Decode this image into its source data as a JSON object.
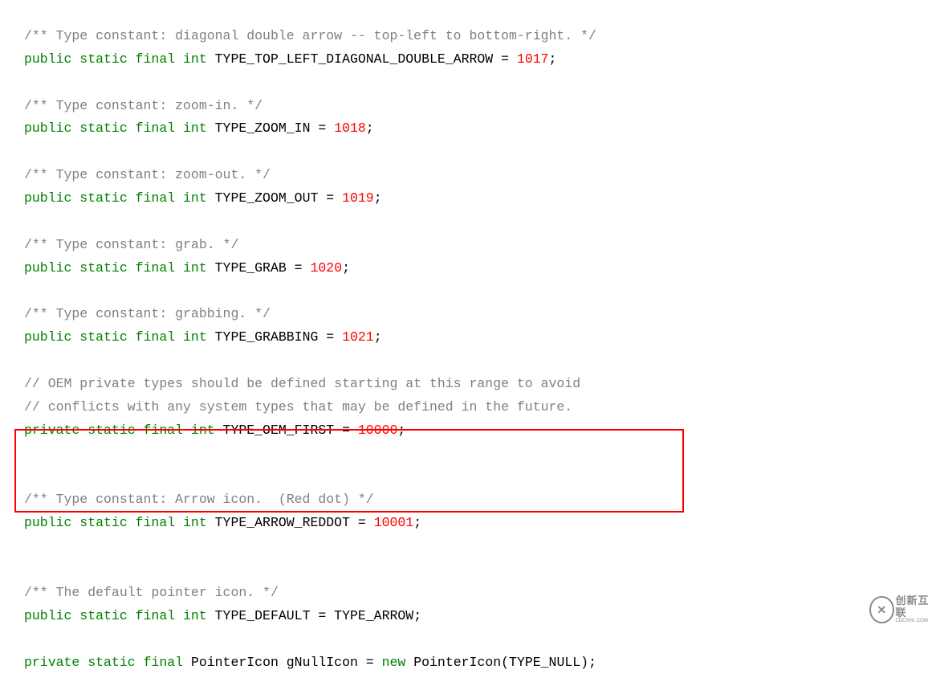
{
  "lines": {
    "c1": "/** Type constant: diagonal double arrow -- top-left to bottom-right. */",
    "l1_kw": "public static final int",
    "l1_id": " TYPE_TOP_LEFT_DIAGONAL_DOUBLE_ARROW = ",
    "l1_num": "1017",
    "semi": ";",
    "c2": "/** Type constant: zoom-in. */",
    "l2_kw": "public static final int",
    "l2_id": " TYPE_ZOOM_IN = ",
    "l2_num": "1018",
    "c3": "/** Type constant: zoom-out. */",
    "l3_kw": "public static final int",
    "l3_id": " TYPE_ZOOM_OUT = ",
    "l3_num": "1019",
    "c4": "/** Type constant: grab. */",
    "l4_kw": "public static final int",
    "l4_id": " TYPE_GRAB = ",
    "l4_num": "1020",
    "c5": "/** Type constant: grabbing. */",
    "l5_kw": "public static final int",
    "l5_id": " TYPE_GRABBING = ",
    "l5_num": "1021",
    "c6a": "// OEM private types should be defined starting at this range to avoid",
    "c6b": "// conflicts with any system types that may be defined in the future.",
    "l6_kw": "private static final int",
    "l6_id": " TYPE_OEM_FIRST = ",
    "l6_num": "10000",
    "c7": "/** Type constant: Arrow icon.  (Red dot) */",
    "l7_kw": "public static final int",
    "l7_id": " TYPE_ARROW_REDDOT = ",
    "l7_num": "10001",
    "c8": "/** The default pointer icon. */",
    "l8_kw": "public static final int",
    "l8_id": " TYPE_DEFAULT = TYPE_ARROW;",
    "l9_kw": "private static final",
    "l9_type": " PointerIcon",
    "l9_id": " gNullIcon = ",
    "l9_new": "new",
    "l9_ctor": " PointerIcon(TYPE_NULL);"
  },
  "logo": {
    "cn": "创新互联",
    "en": "CDCXHL.COM"
  }
}
